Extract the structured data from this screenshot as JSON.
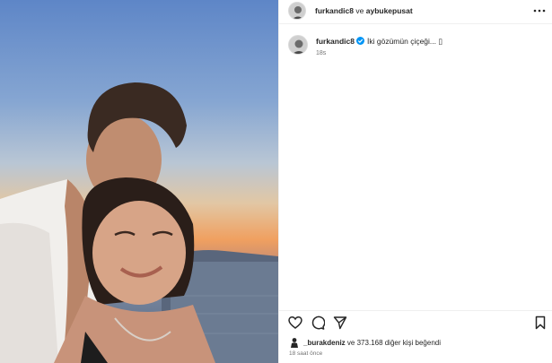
{
  "header": {
    "author": "furkandic8",
    "connector": "ve",
    "coauthor": "aybukepusat",
    "more_icon": "ellipsis-icon"
  },
  "caption": {
    "username": "furkandic8",
    "verified": true,
    "text": "İki gözümün çiçeği... ▯",
    "time": "18s"
  },
  "actions": {
    "icons": [
      "heart-icon",
      "comment-icon",
      "share-icon",
      "bookmark-icon"
    ]
  },
  "likes": {
    "liker": "_burakdeniz",
    "rest": "ve 373.168 diğer kişi beğendi"
  },
  "post_time": "18 saat önce",
  "colors": {
    "accent": "#0095f6",
    "text": "#262626",
    "muted": "#737373",
    "border": "#efefef"
  }
}
